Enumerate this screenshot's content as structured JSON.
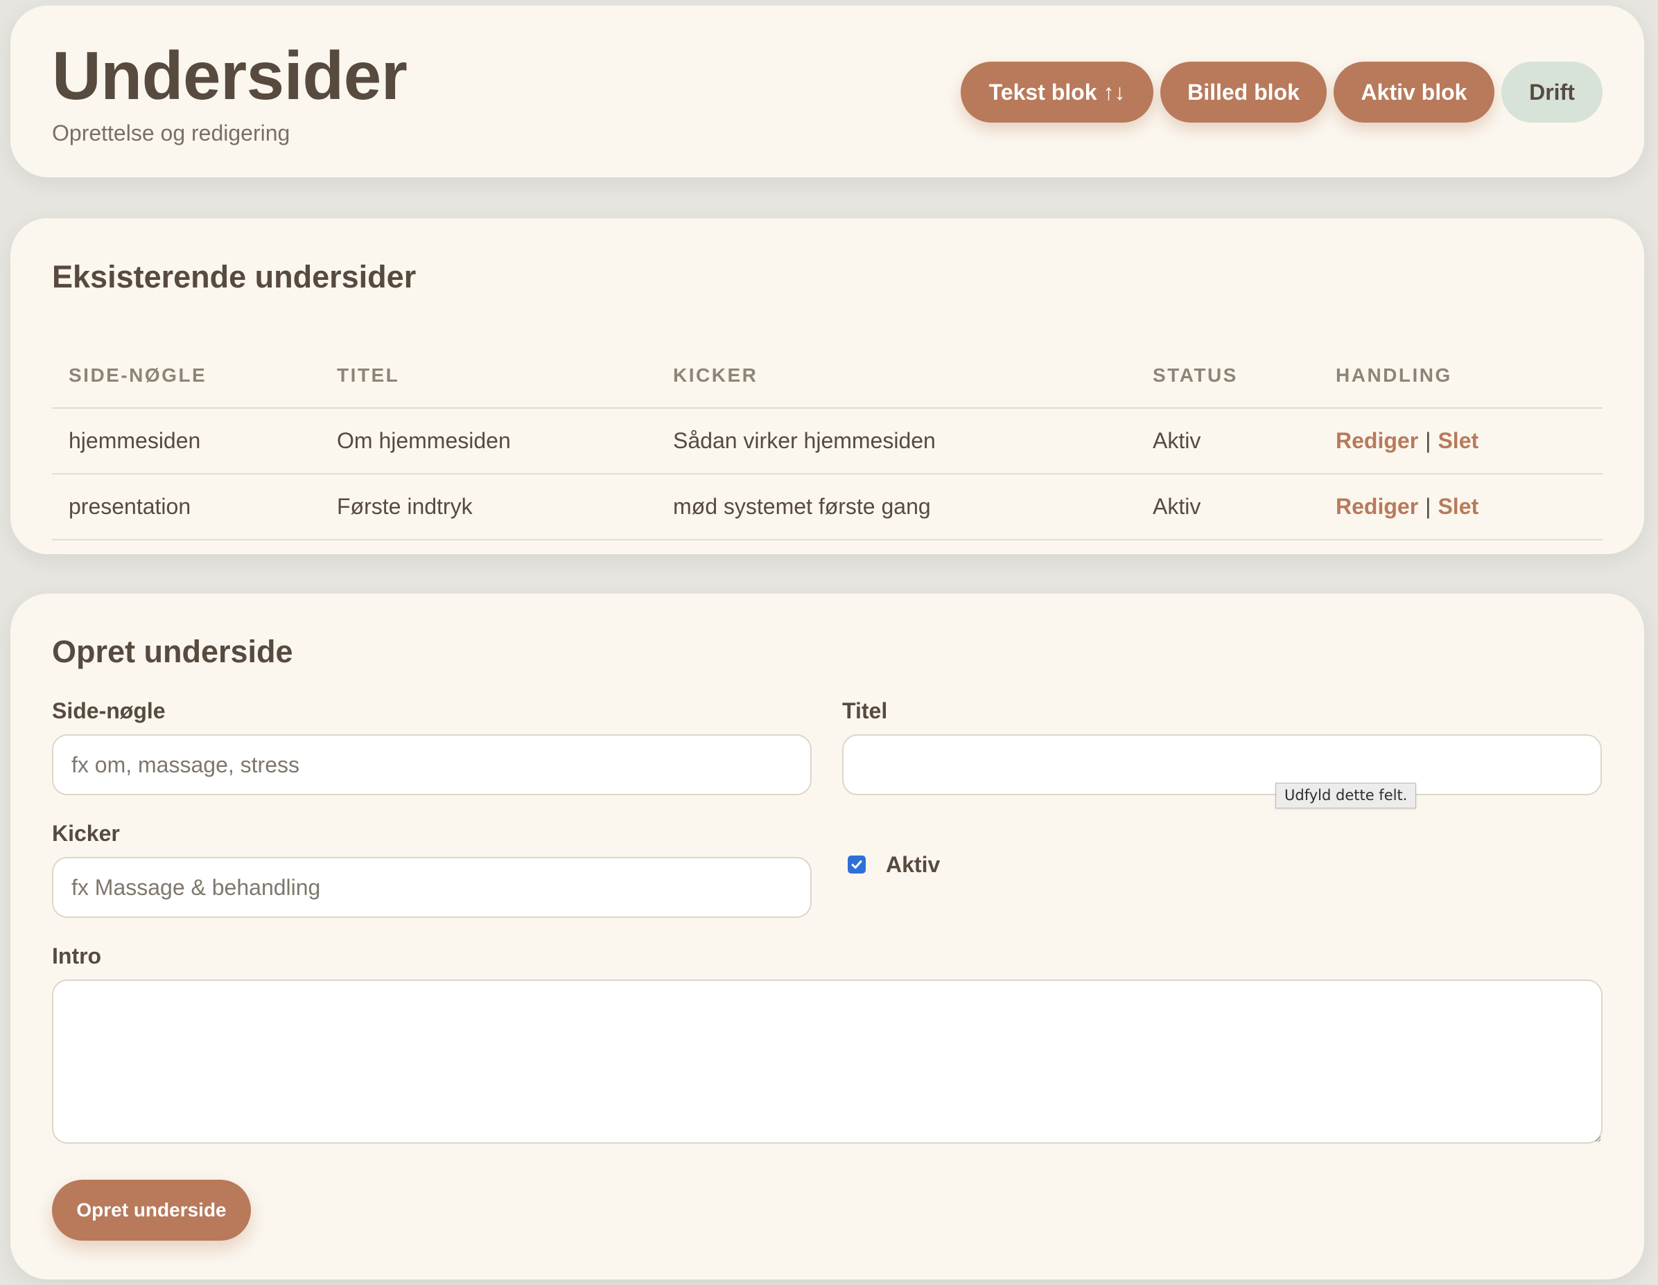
{
  "header": {
    "title": "Undersider",
    "subtitle": "Oprettelse og redigering",
    "nav": [
      {
        "label": "Tekst blok ↑↓",
        "style": "brown"
      },
      {
        "label": "Billed blok",
        "style": "brown"
      },
      {
        "label": "Aktiv blok",
        "style": "brown"
      },
      {
        "label": "Drift",
        "style": "mint"
      }
    ]
  },
  "existing": {
    "title": "Eksisterende undersider",
    "columns": [
      "SIDE-NØGLE",
      "TITEL",
      "KICKER",
      "STATUS",
      "HANDLING"
    ],
    "rows": [
      {
        "key": "hjemmesiden",
        "title": "Om hjemmesiden",
        "kicker": "Sådan virker hjemmesiden",
        "status": "Aktiv",
        "edit": "Rediger",
        "sep": "|",
        "delete": "Slet"
      },
      {
        "key": "presentation",
        "title": "Første indtryk",
        "kicker": "mød systemet første gang",
        "status": "Aktiv",
        "edit": "Rediger",
        "sep": "|",
        "delete": "Slet"
      }
    ]
  },
  "form": {
    "title": "Opret underside",
    "key_label": "Side-nøgle",
    "key_placeholder": "fx om, massage, stress",
    "key_value": "",
    "title_label": "Titel",
    "title_value": "",
    "tooltip": "Udfyld dette felt.",
    "kicker_label": "Kicker",
    "kicker_placeholder": "fx Massage & behandling",
    "kicker_value": "",
    "active_label": "Aktiv",
    "active_checked": true,
    "intro_label": "Intro",
    "intro_value": "",
    "submit_label": "Opret underside"
  },
  "colors": {
    "accent": "#b87a5b",
    "mint": "#d7e2d9",
    "card": "#fbf7ef",
    "background": "#e6e5e0",
    "text": "#574a3e",
    "checkbox": "#2f6fd8"
  }
}
